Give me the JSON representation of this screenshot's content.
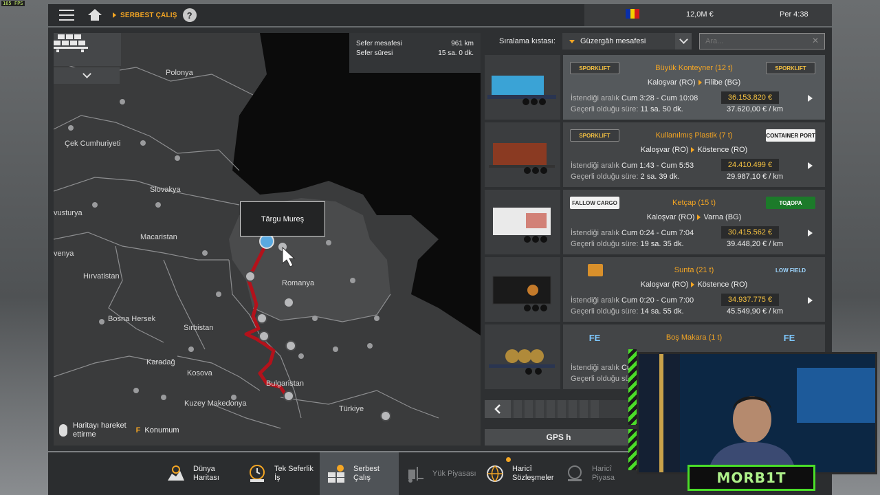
{
  "overlay": {
    "fps": "165 FPS"
  },
  "topbar": {
    "breadcrumb": "SERBEST ÇALIŞ",
    "help": "?",
    "money": "12,0M  €",
    "clock": "Per 4:38",
    "flag_colors": [
      "#0a2fa8",
      "#f5d000",
      "#d21a1a"
    ]
  },
  "map": {
    "trip": {
      "distance_label": "Sefer mesafesi",
      "distance_value": "961 km",
      "duration_label": "Sefer süresi",
      "duration_value": "15 sa. 0 dk."
    },
    "tooltip": "Târgu Mureş",
    "countries": {
      "polonya": "Polonya",
      "cek": "Çek Cumhuriyeti",
      "slovakya": "Slovakya",
      "avusturya": "vusturya",
      "macaristan": "Macaristan",
      "slovenya": "venya",
      "hirvatistan": "Hırvatistan",
      "romanya": "Romanya",
      "bosna": "Bosna Hersek",
      "sirbistan": "Sırbistan",
      "karadag": "Karadağ",
      "kosova": "Kosova",
      "bulgaristan": "Bulgaristan",
      "kuzey_makedonya": "Kuzey Makedonya",
      "turkiye": "Türkiye"
    },
    "hint_move": "Haritayı hareket\nettirme",
    "hint_key": "F",
    "hint_location": "Konumum",
    "route_color": "#b3121b"
  },
  "sort": {
    "label": "Sıralama kıstası:",
    "value": "Güzergâh mesafesi",
    "search_placeholder": "Ara..."
  },
  "jobs": [
    {
      "title": "Büyük Konteyner (12 t)",
      "from": "Kaloşvar (RO)",
      "to": "Filibe (BG)",
      "range_label": "İstendiği aralık",
      "range": "Cum 3:28 - Cum 10:08",
      "valid_label": "Geçerli olduğu süre:",
      "valid": "11 sa. 50 dk.",
      "price": "36.153.820 €",
      "perkm": "37.620,00 € / km",
      "logo_left": "SPORKLIFT",
      "logo_right": "SPORKLIFT",
      "cargo_color": "#3aa3d6"
    },
    {
      "title": "Kullanılmış Plastik (7 t)",
      "from": "Kaloşvar (RO)",
      "to": "Köstence (RO)",
      "range_label": "İstendiği aralık",
      "range": "Cum 1:43 - Cum 5:53",
      "valid_label": "Geçerli olduğu süre:",
      "valid": "2 sa. 39 dk.",
      "price": "24.410.499 €",
      "perkm": "29.987,10 € / km",
      "logo_left": "SPORKLIFT",
      "logo_right": "CONTAINER PORT",
      "cargo_color": "#8a3a22"
    },
    {
      "title": "Ketçap (15 t)",
      "from": "Kaloşvar (RO)",
      "to": "Varna (BG)",
      "range_label": "İstendiği aralık",
      "range": "Cum 0:24 - Cum 7:04",
      "valid_label": "Geçerli olduğu süre:",
      "valid": "19 sa. 35 dk.",
      "price": "30.415.562 €",
      "perkm": "39.448,20 € / km",
      "logo_left": "FALLOW CARGO",
      "logo_right": "ТОДОРА",
      "cargo_color": "#e8e8e8"
    },
    {
      "title": "Sunta (21 t)",
      "from": "Kaloşvar (RO)",
      "to": "Köstence (RO)",
      "range_label": "İstendiği aralık",
      "range": "Cum 0:20 - Cum 7:00",
      "valid_label": "Geçerli olduğu süre:",
      "valid": "14 sa. 55 dk.",
      "price": "34.937.775 €",
      "perkm": "45.549,90 € / km",
      "logo_left": "",
      "logo_right": "LOW FIELD",
      "cargo_color": "#1a1a1a"
    },
    {
      "title": "Boş Makara (1 t)",
      "from": "",
      "to": "",
      "range_label": "İstendiği aralık",
      "range": "Cu",
      "valid_label": "Geçerli olduğu sü",
      "valid": "",
      "price": "",
      "perkm": "",
      "logo_left": "FE",
      "logo_right": "FE",
      "cargo_color": "#b08a3a"
    }
  ],
  "gps_button": "GPS h",
  "nav": {
    "world_map": "Dünya\nHaritası",
    "single_job": "Tek Seferlik\nİş",
    "freelance": "Serbest\nÇalış",
    "cargo_market": "Yük Piyasası",
    "external_contracts": "Haricî\nSözleşmeler",
    "external_market": "Haricî\nPiyasa"
  },
  "webcam": {
    "name": "MORB1T",
    "accent": "#4ade28"
  }
}
